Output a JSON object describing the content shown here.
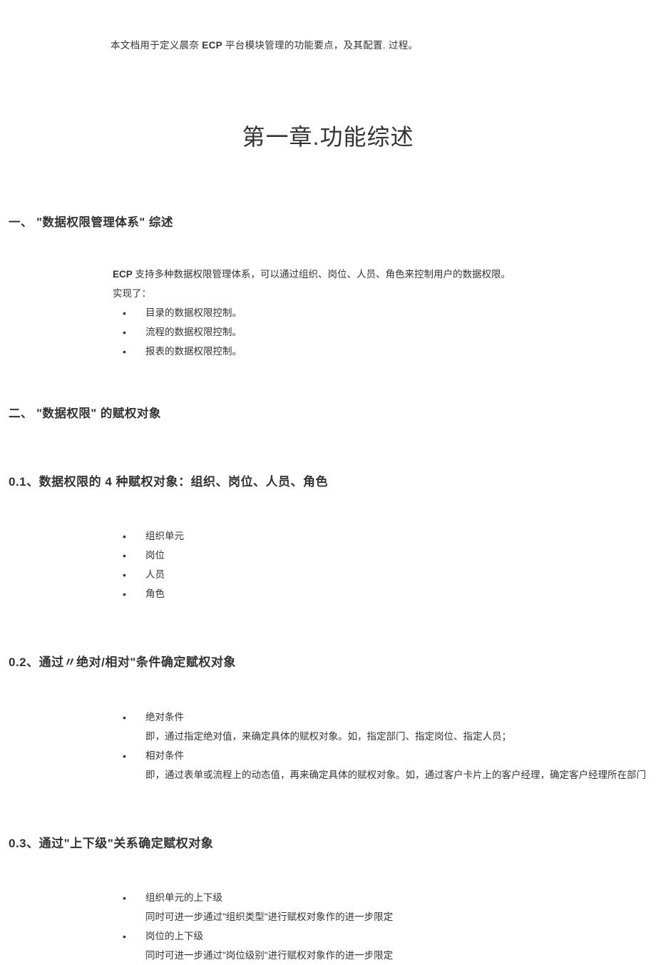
{
  "intro": {
    "prefix": "本文档用于定义晨奈 ",
    "bold": "ECP",
    "suffix": " 平台模块管理的功能要点，及其配置. 过程。"
  },
  "chapter_title": "第一章.功能综述",
  "h1_1": "一、 \"数据权限管理体系\" 综述",
  "body1": {
    "line1_bold": "ECP",
    "line1_rest": " 支持多种数据权限管理体系，可以通过组织、岗位、人员、角色来控制用户的数据权限。",
    "line2": "实现了：",
    "items": [
      "目录的数据权限控制。",
      "流程的数据权限控制。",
      "报表的数据权限控制。"
    ]
  },
  "h1_2": "二、 \"数据权限\" 的赋权对象",
  "h2_01": "0.1、数据权限的 4 种赋权对象：组织、岗位、人员、角色",
  "list01": [
    "组织单元",
    "岗位",
    "人员",
    "角色"
  ],
  "h2_02": "0.2、通过〃绝对/相对\"条件确定赋权对象",
  "list02": [
    {
      "title": "绝对条件",
      "note": "即，通过指定绝对值，来确定具体的赋权对象。如，指定部门、指定岗位、指定人员；"
    },
    {
      "title": "相对条件",
      "note": "即，通过表单或流程上的动态值，再来确定具体的赋权对象。如，通过客户卡片上的客户经理，确定客户经理所在部门"
    }
  ],
  "h2_03": "0.3、通过\"上下级\"关系确定赋权对象",
  "list03": [
    {
      "title": "组织单元的上下级",
      "note": "同时可进一步通过\"组织类型\"进行赋权对象作的进一步限定"
    },
    {
      "title": "岗位的上下级",
      "note": "同时可进一步通过\"岗位级别\"进行赋权对象作的进一步限定"
    }
  ]
}
